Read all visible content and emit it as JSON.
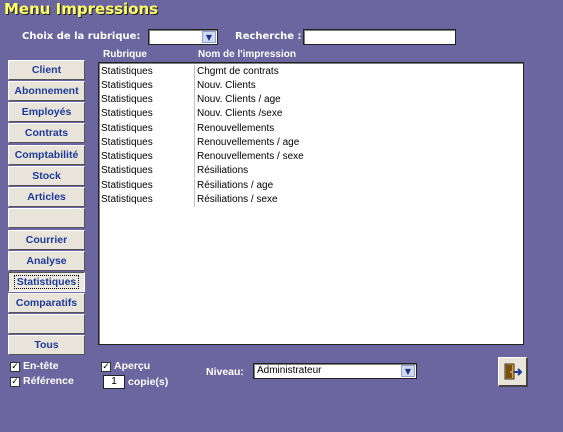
{
  "window": {
    "title": "Menu Impressions"
  },
  "filter": {
    "rubrique_label": "Choix de la rubrique:",
    "rubrique_value": "",
    "search_label": "Recherche :",
    "search_value": ""
  },
  "nav": {
    "items": [
      {
        "label": "Client"
      },
      {
        "label": "Abonnement"
      },
      {
        "label": "Employés"
      },
      {
        "label": "Contrats"
      },
      {
        "label": "Comptabilité"
      },
      {
        "label": "Stock"
      },
      {
        "label": "Articles"
      },
      {
        "label": ""
      },
      {
        "label": "Courrier"
      },
      {
        "label": "Analyse"
      },
      {
        "label": "Statistiques"
      },
      {
        "label": "Comparatifs"
      },
      {
        "label": ""
      },
      {
        "label": "Tous"
      }
    ],
    "active": "Statistiques"
  },
  "list": {
    "headers": {
      "rubrique": "Rubrique",
      "nom": "Nom de l'impression"
    },
    "rows": [
      {
        "rubrique": "Statistiques",
        "nom": "Chgmt de contrats"
      },
      {
        "rubrique": "Statistiques",
        "nom": "Nouv. Clients"
      },
      {
        "rubrique": "Statistiques",
        "nom": "Nouv. Clients / age"
      },
      {
        "rubrique": "Statistiques",
        "nom": "Nouv. Clients /sexe"
      },
      {
        "rubrique": "Statistiques",
        "nom": "Renouvellements"
      },
      {
        "rubrique": "Statistiques",
        "nom": "Renouvellements / age"
      },
      {
        "rubrique": "Statistiques",
        "nom": "Renouvellements / sexe"
      },
      {
        "rubrique": "Statistiques",
        "nom": "Résiliations"
      },
      {
        "rubrique": "Statistiques",
        "nom": "Résiliations / age"
      },
      {
        "rubrique": "Statistiques",
        "nom": "Résiliations / sexe"
      }
    ]
  },
  "options": {
    "entete": {
      "label": "En-tête",
      "checked": true
    },
    "reference": {
      "label": "Référence",
      "checked": true
    },
    "apercu": {
      "label": "Aperçu",
      "checked": true
    },
    "copies_value": "1",
    "copies_label": "copie(s)",
    "niveau_label": "Niveau:",
    "niveau_value": "Administrateur"
  },
  "icons": {
    "dropdown": "chevron-down-icon",
    "exit": "exit-door-icon",
    "check": "checkmark-icon"
  },
  "colors": {
    "background": "#6b66a0",
    "title": "#ffff66",
    "nav_text": "#1e3a9a"
  }
}
